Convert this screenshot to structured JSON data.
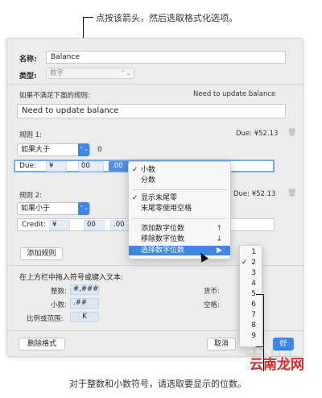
{
  "captions": {
    "top": "点按该箭头，然后选取格式化选项。",
    "bottom": "对于整数和小数符号，请选取要显示的位数。"
  },
  "form": {
    "name_label": "名称:",
    "name_value": "Balance",
    "type_label": "类型:",
    "type_value": "数字",
    "rule_fail_label": "如果不满足下面的规则:",
    "rule_fail_hint": "Need to update balance",
    "rule_fail_value": "Need to update balance"
  },
  "rule1": {
    "title": "规则 1:",
    "preview": "Due: ¥52.13",
    "condition": "如果大于",
    "condition_value": "0",
    "prefix": "Due:",
    "tokens": [
      "¥",
      "00",
      ".00"
    ]
  },
  "rule2": {
    "title": "规则 2:",
    "preview": "Due: ¥52.13",
    "condition": "如果小于",
    "prefix": "Credit:",
    "tokens": [
      "¥",
      "00",
      ".00"
    ]
  },
  "add_rule_label": "添加规则",
  "tokens_section": {
    "title": "在上方栏中拖入符号或键入文本:",
    "integer_label": "整数:",
    "integer_token": "#,###",
    "decimal_label": "小数:",
    "decimal_token": ".##",
    "ratio_label": "比例或范围:",
    "ratio_token": "K",
    "currency_label": "货币:",
    "space_label": "空格:"
  },
  "footer": {
    "delete_label": "删除格式",
    "cancel_label": "取消",
    "ok_label": "好"
  },
  "menu": {
    "items": [
      {
        "label": "小数",
        "checked": true
      },
      {
        "label": "分数",
        "checked": false
      },
      {
        "label": "显示末尾零",
        "checked": true
      },
      {
        "label": "末尾零使用空格",
        "checked": false
      },
      {
        "label": "添加数字位数",
        "shortcut": "↑"
      },
      {
        "label": "移除数字位数",
        "shortcut": "↓"
      },
      {
        "label": "选择数字位数",
        "shortcut": "▶"
      }
    ]
  },
  "submenu": {
    "items": [
      "1",
      "2",
      "3",
      "4",
      "5",
      "6",
      "7",
      "8",
      "9"
    ],
    "checked": "2"
  },
  "watermark": {
    "text": "云南龙网",
    "ghost": "龙网"
  },
  "icons": {
    "trash": "trash-icon",
    "popup": "chevron-updown-icon",
    "cursor": "mouse-pointer-icon"
  }
}
